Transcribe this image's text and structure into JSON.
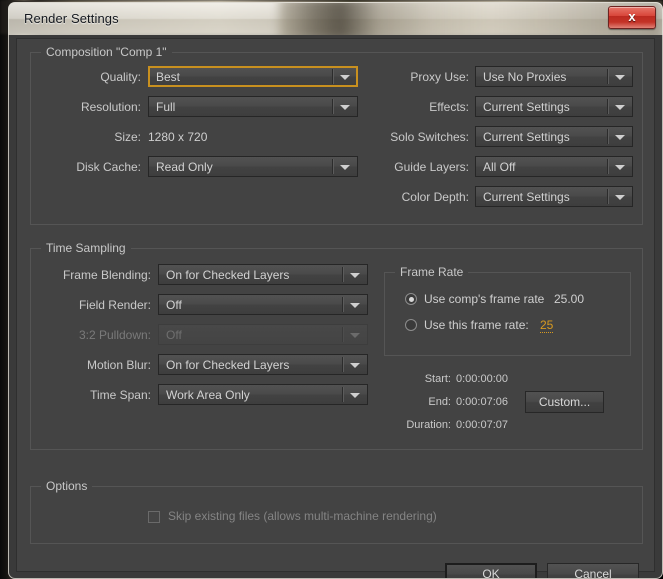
{
  "window": {
    "title": "Render Settings",
    "close_icon": "close-x-icon"
  },
  "composition": {
    "legend": "Composition \"Comp 1\"",
    "rows": [
      {
        "label": "Quality:",
        "value": "Best",
        "focused": true
      },
      {
        "label": "Resolution:",
        "value": "Full",
        "focused": false
      },
      {
        "label": "Disk Cache:",
        "value": "Read Only",
        "focused": false
      }
    ],
    "size_label": "Size:",
    "size_value": "1280 x 720",
    "right_rows": [
      {
        "label": "Proxy Use:",
        "value": "Use No Proxies"
      },
      {
        "label": "Effects:",
        "value": "Current Settings"
      },
      {
        "label": "Solo Switches:",
        "value": "Current Settings"
      },
      {
        "label": "Guide Layers:",
        "value": "All Off"
      },
      {
        "label": "Color Depth:",
        "value": "Current Settings"
      }
    ]
  },
  "time_sampling": {
    "legend": "Time Sampling",
    "rows": [
      {
        "label": "Frame Blending:",
        "value": "On for Checked Layers",
        "disabled": false
      },
      {
        "label": "Field Render:",
        "value": "Off",
        "disabled": false
      },
      {
        "label": "3:2 Pulldown:",
        "value": "Off",
        "disabled": true
      },
      {
        "label": "Motion Blur:",
        "value": "On for Checked Layers",
        "disabled": false
      },
      {
        "label": "Time Span:",
        "value": "Work Area Only",
        "disabled": false
      }
    ],
    "frame_rate": {
      "legend": "Frame Rate",
      "option_comp_label": "Use comp's frame rate",
      "option_comp_value": "25.00",
      "option_comp_selected": true,
      "option_this_label": "Use this frame rate:",
      "option_this_value": "25",
      "option_this_selected": false
    },
    "timecodes": [
      {
        "label": "Start:",
        "value": "0:00:00:00"
      },
      {
        "label": "End:",
        "value": "0:00:07:06"
      },
      {
        "label": "Duration:",
        "value": "0:00:07:07"
      }
    ],
    "custom_button": "Custom..."
  },
  "options": {
    "legend": "Options",
    "skip_existing_label": "Skip existing files (allows multi-machine rendering)",
    "skip_existing_checked": false
  },
  "footer": {
    "ok": "OK",
    "cancel": "Cancel"
  },
  "colors": {
    "dialog_bg": "#434343",
    "panel_border": "#555555",
    "accent_orange": "#d89a20",
    "focus_orange": "#c8901f",
    "text": "#c9c9c9",
    "text_disabled": "#7a7a7a",
    "close_red": "#c43327"
  }
}
